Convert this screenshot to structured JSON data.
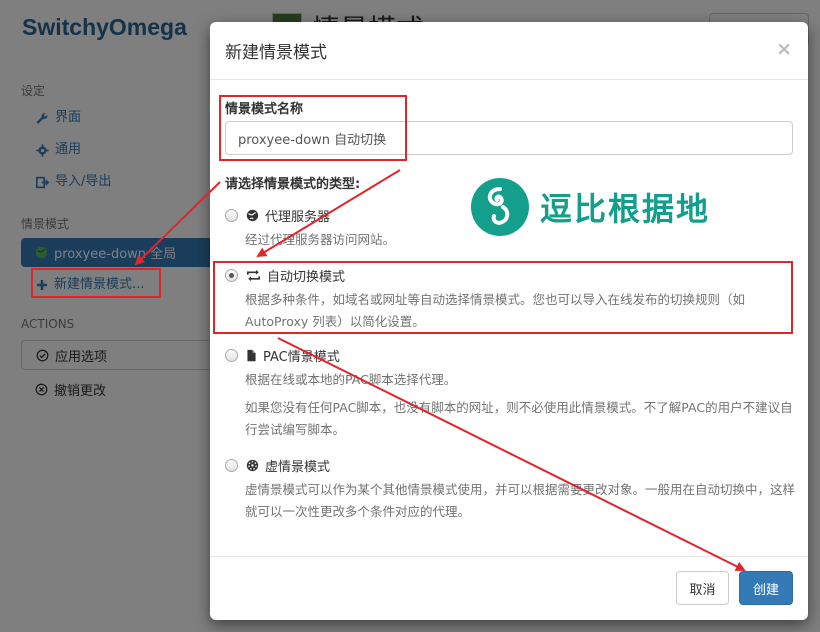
{
  "app": {
    "title": "SwitchyOmega"
  },
  "sidebar": {
    "settings_header": "设定",
    "settings_items": [
      {
        "label": "界面",
        "icon": "wrench-icon"
      },
      {
        "label": "通用",
        "icon": "gear-icon"
      },
      {
        "label": "导入/导出",
        "icon": "import-export-icon"
      }
    ],
    "profiles_header": "情景模式",
    "profiles": [
      {
        "label": "proxyee-down 全局",
        "icon": "globe-icon"
      }
    ],
    "new_profile": "新建情景模式...",
    "actions_header": "ACTIONS",
    "apply": "应用选项",
    "discard": "撤销更改"
  },
  "background": {
    "heading": "情景模式",
    "swatch_color": "#4b7d3a"
  },
  "modal": {
    "title": "新建情景模式",
    "close": "×",
    "name_label": "情景模式名称",
    "name_value": "proxyee-down 自动切换",
    "type_label": "请选择情景模式的类型:",
    "options": [
      {
        "label": "代理服务器",
        "icon": "globe-icon",
        "checked": false,
        "desc": [
          "经过代理服务器访问网站。"
        ]
      },
      {
        "label": "自动切换模式",
        "icon": "switch-icon",
        "checked": true,
        "desc": [
          "根据多种条件，如域名或网址等自动选择情景模式。您也可以导入在线发布的切换规则（如 AutoProxy 列表）以简化设置。"
        ]
      },
      {
        "label": "PAC情景模式",
        "icon": "file-icon",
        "checked": false,
        "desc": [
          "根据在线或本地的PAC脚本选择代理。",
          "如果您没有任何PAC脚本，也没有脚本的网址，则不必使用此情景模式。不了解PAC的用户不建议自行尝试编写脚本。"
        ]
      },
      {
        "label": "虚情景模式",
        "icon": "virtual-icon",
        "checked": false,
        "desc": [
          "虚情景模式可以作为某个其他情景模式使用，并可以根据需要更改对象。一般用在自动切换中，这样就可以一次性更改多个条件对应的代理。"
        ]
      }
    ],
    "cancel": "取消",
    "create": "创建"
  },
  "watermark": {
    "text": "逗比根据地",
    "icon": "spiral-logo-icon",
    "color": "#149e8c"
  },
  "colors": {
    "accent": "#337ab7",
    "annotation": "#e0252c"
  }
}
